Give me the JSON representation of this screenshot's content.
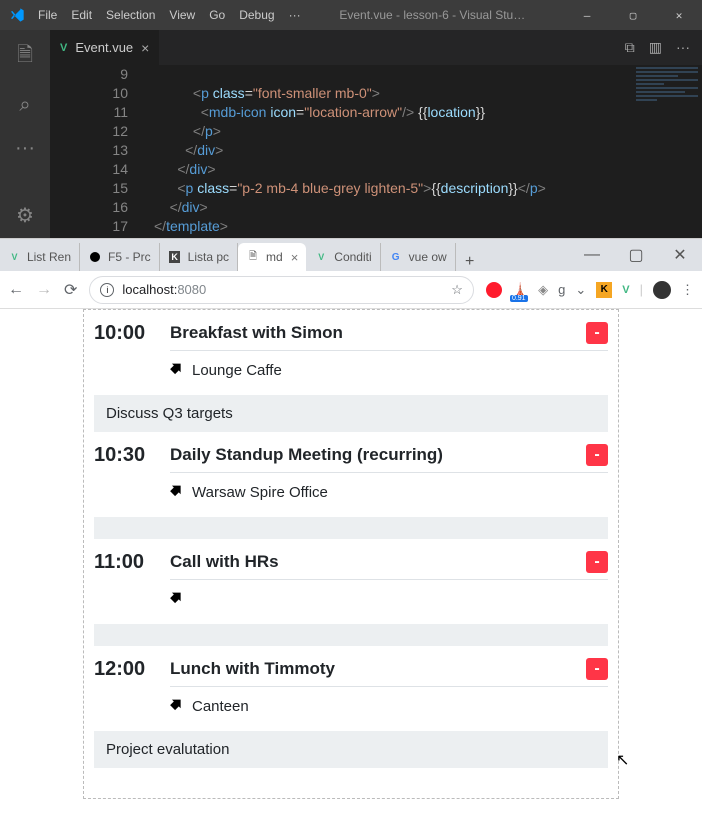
{
  "vscode": {
    "menu": [
      "File",
      "Edit",
      "Selection",
      "View",
      "Go",
      "Debug",
      "···"
    ],
    "title": "Event.vue - lesson-6 - Visual Stu…",
    "tab": {
      "name": "Event.vue",
      "close": "×"
    },
    "tabbar_icons": {
      "split": "⧉",
      "layout": "▥",
      "more": "···"
    },
    "lines": [
      {
        "n": "9",
        "html": ""
      },
      {
        "n": "10",
        "html": "          <span class='cl-tag'>&lt;</span><span class='cl-name'>p</span> <span class='cl-attr'>class</span>=<span class='cl-str'>\"font-smaller mb-0\"</span><span class='cl-tag'>&gt;</span>"
      },
      {
        "n": "11",
        "html": "            <span class='cl-tag'>&lt;</span><span class='cl-name'>mdb-icon</span> <span class='cl-attr'>icon</span>=<span class='cl-str'>\"location-arrow\"</span><span class='cl-tag'>/&gt;</span> <span class='cl-brace'>{{</span><span class='cl-var'>location</span><span class='cl-brace'>}}</span>"
      },
      {
        "n": "12",
        "html": "          <span class='cl-tag'>&lt;/</span><span class='cl-name'>p</span><span class='cl-tag'>&gt;</span>"
      },
      {
        "n": "13",
        "html": "        <span class='cl-tag'>&lt;/</span><span class='cl-name'>div</span><span class='cl-tag'>&gt;</span>"
      },
      {
        "n": "14",
        "html": "      <span class='cl-tag'>&lt;/</span><span class='cl-name'>div</span><span class='cl-tag'>&gt;</span>"
      },
      {
        "n": "15",
        "html": "      <span class='cl-tag'>&lt;</span><span class='cl-name'>p</span> <span class='cl-attr'>class</span>=<span class='cl-str'>\"p-2 mb-4 blue-grey lighten-5\"</span><span class='cl-tag'>&gt;</span><span class='cl-brace'>{{</span><span class='cl-var'>description</span><span class='cl-brace'>}}</span><span class='cl-tag'>&lt;/</span><span class='cl-name'>p</span><span class='cl-tag'>&gt;</span>"
      },
      {
        "n": "16",
        "html": "    <span class='cl-tag'>&lt;/</span><span class='cl-name'>div</span><span class='cl-tag'>&gt;</span>"
      },
      {
        "n": "17",
        "html": "<span class='cl-tag'>&lt;/</span><span class='cl-name'>template</span><span class='cl-tag'>&gt;</span>"
      }
    ]
  },
  "browser": {
    "tabs": [
      {
        "icon": "vue",
        "label": "List Ren"
      },
      {
        "icon": "dot",
        "label": "F5 - Prc"
      },
      {
        "icon": "k",
        "label": "Lista pc"
      },
      {
        "icon": "file",
        "label": "md",
        "active": true
      },
      {
        "icon": "vue",
        "label": "Conditi"
      },
      {
        "icon": "g",
        "label": "vue ow"
      }
    ],
    "newtab": "+",
    "url_host": "localhost:",
    "url_port": "8080",
    "lighthouse_badge": "0.91",
    "events": [
      {
        "time": "10:00",
        "title": "Breakfast with Simon",
        "location": "Lounge Caffe",
        "desc": "Discuss Q3 targets"
      },
      {
        "time": "10:30",
        "title": "Daily Standup Meeting (recurring)",
        "location": "Warsaw Spire Office",
        "desc": ""
      },
      {
        "time": "11:00",
        "title": "Call with HRs",
        "location": "",
        "desc": ""
      },
      {
        "time": "12:00",
        "title": "Lunch with Timmoty",
        "location": "Canteen",
        "desc": "Project evalutation"
      }
    ],
    "delete_label": "-"
  }
}
